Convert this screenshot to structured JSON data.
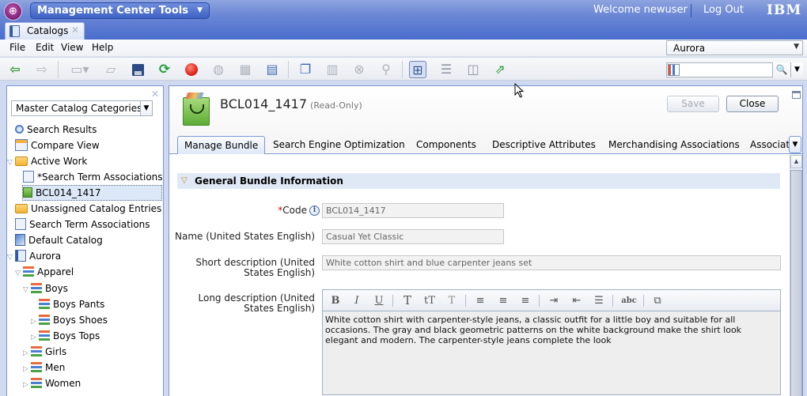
{
  "banner": {
    "app_menu_label": "Management Center Tools",
    "welcome_text": "Welcome newuser",
    "logout_label": "Log Out",
    "brand": "IBM"
  },
  "open_tab": {
    "label": "Catalogs",
    "close_icon": "close-icon"
  },
  "menubar": {
    "items": [
      "File",
      "Edit",
      "View",
      "Help"
    ]
  },
  "store_selector": {
    "value": "Aurora"
  },
  "toolbar": {
    "icons": [
      "back-arrow-icon",
      "forward-arrow-icon",
      "new-object-icon",
      "open-icon",
      "save-icon",
      "refresh-icon",
      "stop-icon",
      "globe-icon",
      "report-icon",
      "monitor-icon",
      "copy-icon",
      "paste-icon",
      "delete-icon",
      "find-references-icon",
      "tree-view-icon",
      "horizontal-layout-icon",
      "vertical-layout-icon",
      "export-icon"
    ]
  },
  "search": {
    "value": "",
    "placeholder": ""
  },
  "left_panel": {
    "selector_value": "Master Catalog Categories",
    "tree": [
      {
        "label": "Search Results",
        "icon": "search-icon",
        "level": 0,
        "toggle": ""
      },
      {
        "label": "Compare View",
        "icon": "compare-icon",
        "level": 0,
        "toggle": ""
      },
      {
        "label": "Active Work",
        "icon": "folder-icon",
        "level": 0,
        "toggle": "expanded"
      },
      {
        "label": "*Search Term Associations",
        "icon": "search-term-icon",
        "level": 1,
        "toggle": ""
      },
      {
        "label": "BCL014_1417",
        "icon": "bundle-icon",
        "level": 1,
        "toggle": "",
        "selected": true
      },
      {
        "label": "Unassigned Catalog Entries",
        "icon": "folder-icon",
        "level": 0,
        "toggle": ""
      },
      {
        "label": "Search Term Associations",
        "icon": "search-term-icon",
        "level": 0,
        "toggle": ""
      },
      {
        "label": "Default Catalog",
        "icon": "catalog-icon",
        "level": 0,
        "toggle": ""
      },
      {
        "label": "Aurora",
        "icon": "book-icon",
        "level": 0,
        "toggle": "expanded"
      },
      {
        "label": "Apparel",
        "icon": "category-icon",
        "level": 1,
        "toggle": "expanded"
      },
      {
        "label": "Boys",
        "icon": "category-icon",
        "level": 2,
        "toggle": "expanded"
      },
      {
        "label": "Boys Pants",
        "icon": "category-icon",
        "level": 3,
        "toggle": ""
      },
      {
        "label": "Boys Shoes",
        "icon": "category-icon",
        "level": 3,
        "toggle": "collapsed"
      },
      {
        "label": "Boys Tops",
        "icon": "category-icon",
        "level": 3,
        "toggle": "collapsed"
      },
      {
        "label": "Girls",
        "icon": "category-icon",
        "level": 2,
        "toggle": "collapsed"
      },
      {
        "label": "Men",
        "icon": "category-icon",
        "level": 2,
        "toggle": "collapsed"
      },
      {
        "label": "Women",
        "icon": "category-icon",
        "level": 2,
        "toggle": "collapsed"
      }
    ]
  },
  "object": {
    "title": "BCL014_1417",
    "read_only": "(Read-Only)",
    "save_label": "Save",
    "close_label": "Close",
    "tabs": [
      "Manage Bundle",
      "Search Engine Optimization",
      "Components",
      "Descriptive Attributes",
      "Merchandising Associations",
      "Associate"
    ],
    "active_tab": "Manage Bundle"
  },
  "section": {
    "title": "General Bundle Information",
    "fields": {
      "code": {
        "required_mark": "*",
        "label": "Code",
        "value": "BCL014_1417"
      },
      "name": {
        "label": "Name (United States English)",
        "value": "Casual Yet Classic"
      },
      "short_desc": {
        "label_line1": "Short description (United",
        "label_line2": "States English)",
        "value": "White cotton shirt and blue carpenter jeans set"
      },
      "long_desc": {
        "label_line1": "Long description (United",
        "label_line2": "States English)",
        "value": "White cotton shirt with carpenter-style jeans, a classic outfit for a little boy and suitable for all occasions. The gray and black geometric patterns on the white background make the shirt look elegant and modern. The carpenter-style jeans complete the look"
      }
    },
    "rte_buttons": [
      "B",
      "I",
      "U",
      "T",
      "tT",
      "T",
      "≡",
      "≡",
      "≡",
      "⇥",
      "⇤",
      "☰",
      "abc",
      "⧉"
    ]
  }
}
